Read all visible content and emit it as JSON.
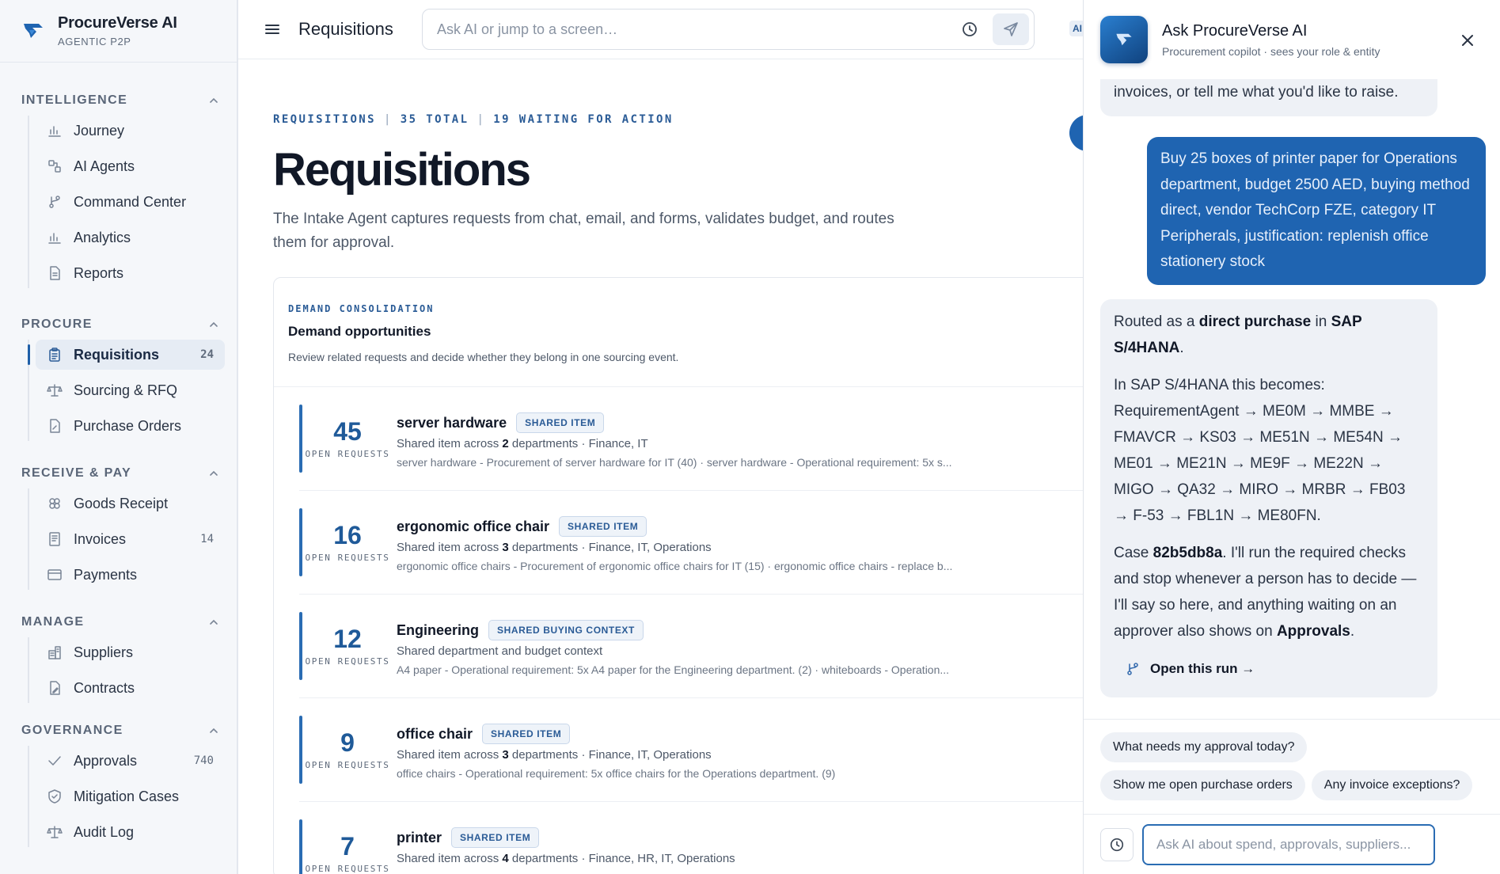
{
  "brand": {
    "name": "ProcureVerse AI",
    "sub": "AGENTIC P2P"
  },
  "sidebar": {
    "sections": [
      {
        "title": "INTELLIGENCE",
        "items": [
          {
            "label": "Journey",
            "icon": "bar-chart-icon",
            "count": ""
          },
          {
            "label": "AI Agents",
            "icon": "agents-icon",
            "count": ""
          },
          {
            "label": "Command Center",
            "icon": "branch-icon",
            "count": ""
          },
          {
            "label": "Analytics",
            "icon": "bar-chart-icon",
            "count": ""
          },
          {
            "label": "Reports",
            "icon": "document-icon",
            "count": ""
          }
        ]
      },
      {
        "title": "PROCURE",
        "items": [
          {
            "label": "Requisitions",
            "icon": "clipboard-icon",
            "count": "24",
            "active": true
          },
          {
            "label": "Sourcing & RFQ",
            "icon": "scale-icon",
            "count": ""
          },
          {
            "label": "Purchase Orders",
            "icon": "file-edit-icon",
            "count": ""
          }
        ]
      },
      {
        "title": "RECEIVE & PAY",
        "items": [
          {
            "label": "Goods Receipt",
            "icon": "boxes-icon",
            "count": ""
          },
          {
            "label": "Invoices",
            "icon": "invoice-icon",
            "count": "14"
          },
          {
            "label": "Payments",
            "icon": "card-icon",
            "count": ""
          }
        ]
      },
      {
        "title": "MANAGE",
        "items": [
          {
            "label": "Suppliers",
            "icon": "building-icon",
            "count": ""
          },
          {
            "label": "Contracts",
            "icon": "contract-icon",
            "count": ""
          }
        ]
      },
      {
        "title": "GOVERNANCE",
        "items": [
          {
            "label": "Approvals",
            "icon": "check-icon",
            "count": "740"
          },
          {
            "label": "Mitigation Cases",
            "icon": "shield-icon",
            "count": ""
          },
          {
            "label": "Audit Log",
            "icon": "scale-icon",
            "count": ""
          }
        ]
      }
    ]
  },
  "topbar": {
    "title": "Requisitions",
    "search_placeholder": "Ask AI or jump to a screen…",
    "ai_badge": "AI"
  },
  "page": {
    "crumb": [
      "REQUISITIONS",
      "35 TOTAL",
      "19 WAITING FOR ACTION"
    ],
    "title": "Requisitions",
    "description": "The Intake Agent captures requests from chat, email, and forms, validates budget, and routes them for approval."
  },
  "demand": {
    "kicker": "DEMAND CONSOLIDATION",
    "title": "Demand opportunities",
    "subtitle": "Review related requests and decide whether they belong in one sourcing event.",
    "count_label": "OPEN REQUESTS",
    "items": [
      {
        "count": "45",
        "name": "server hardware",
        "tag": "SHARED ITEM",
        "pre": "Shared item across ",
        "num": "2",
        "post": " departments · Finance, IT",
        "detail": "server hardware - Procurement of server hardware for IT (40) · server hardware - Operational requirement: 5x s..."
      },
      {
        "count": "16",
        "name": "ergonomic office chair",
        "tag": "SHARED ITEM",
        "pre": "Shared item across ",
        "num": "3",
        "post": " departments · Finance, IT, Operations",
        "detail": "ergonomic office chairs - Procurement of ergonomic office chairs for IT (15) · ergonomic office chairs - replace b..."
      },
      {
        "count": "12",
        "name": "Engineering",
        "tag": "SHARED BUYING CONTEXT",
        "pre": "Shared department and budget context",
        "num": "",
        "post": "",
        "detail": "A4 paper - Operational requirement: 5x A4 paper for the Engineering department. (2) · whiteboards - Operation..."
      },
      {
        "count": "9",
        "name": "office chair",
        "tag": "SHARED ITEM",
        "pre": "Shared item across ",
        "num": "3",
        "post": " departments · Finance, IT, Operations",
        "detail": "office chairs - Operational requirement: 5x office chairs for the Operations department. (9)"
      },
      {
        "count": "7",
        "name": "printer",
        "tag": "SHARED ITEM",
        "pre": "Shared item across ",
        "num": "4",
        "post": " departments · Finance, HR, IT, Operations",
        "detail": ""
      }
    ]
  },
  "assistant": {
    "title": "Ask ProcureVerse AI",
    "subtitle": "Procurement copilot · sees your role & entity",
    "prev_tail": "invoices, or tell me what you'd like to raise.",
    "user_message": "Buy 25 boxes of printer paper for Operations department, budget 2500 AED, buying method direct, vendor TechCorp FZE, category IT Peripherals, justification: replenish office stationery stock",
    "reply": {
      "p1_pre": "Routed as a ",
      "p1_b1": "direct purchase",
      "p1_mid": " in ",
      "p1_b2": "SAP S/4HANA",
      "p1_post": ".",
      "p2": "In SAP S/4HANA this becomes: RequirementAgent → ME0M → MMBE → FMAVCR → KS03 → ME51N → ME54N → ME01 → ME21N → ME9F → ME22N → MIGO → QA32 → MIRO → MRBR → FB03 → F-53 → FBL1N → ME80FN.",
      "p3_pre": "Case ",
      "p3_b1": "82b5db8a",
      "p3_mid": ". I'll run the required checks and stop whenever a person has to decide — I'll say so here, and anything waiting on an approver also shows on ",
      "p3_b2": "Approvals",
      "p3_post": ".",
      "open_run": "Open this run →"
    },
    "suggestions": [
      "What needs my approval today?",
      "Show me open purchase orders",
      "Any invoice exceptions?"
    ],
    "input_placeholder": "Ask AI about spend, approvals, suppliers..."
  },
  "colors": {
    "accent": "#1f64b1",
    "accent_dark": "#1f5a99",
    "bg": "#f4f6f9"
  }
}
